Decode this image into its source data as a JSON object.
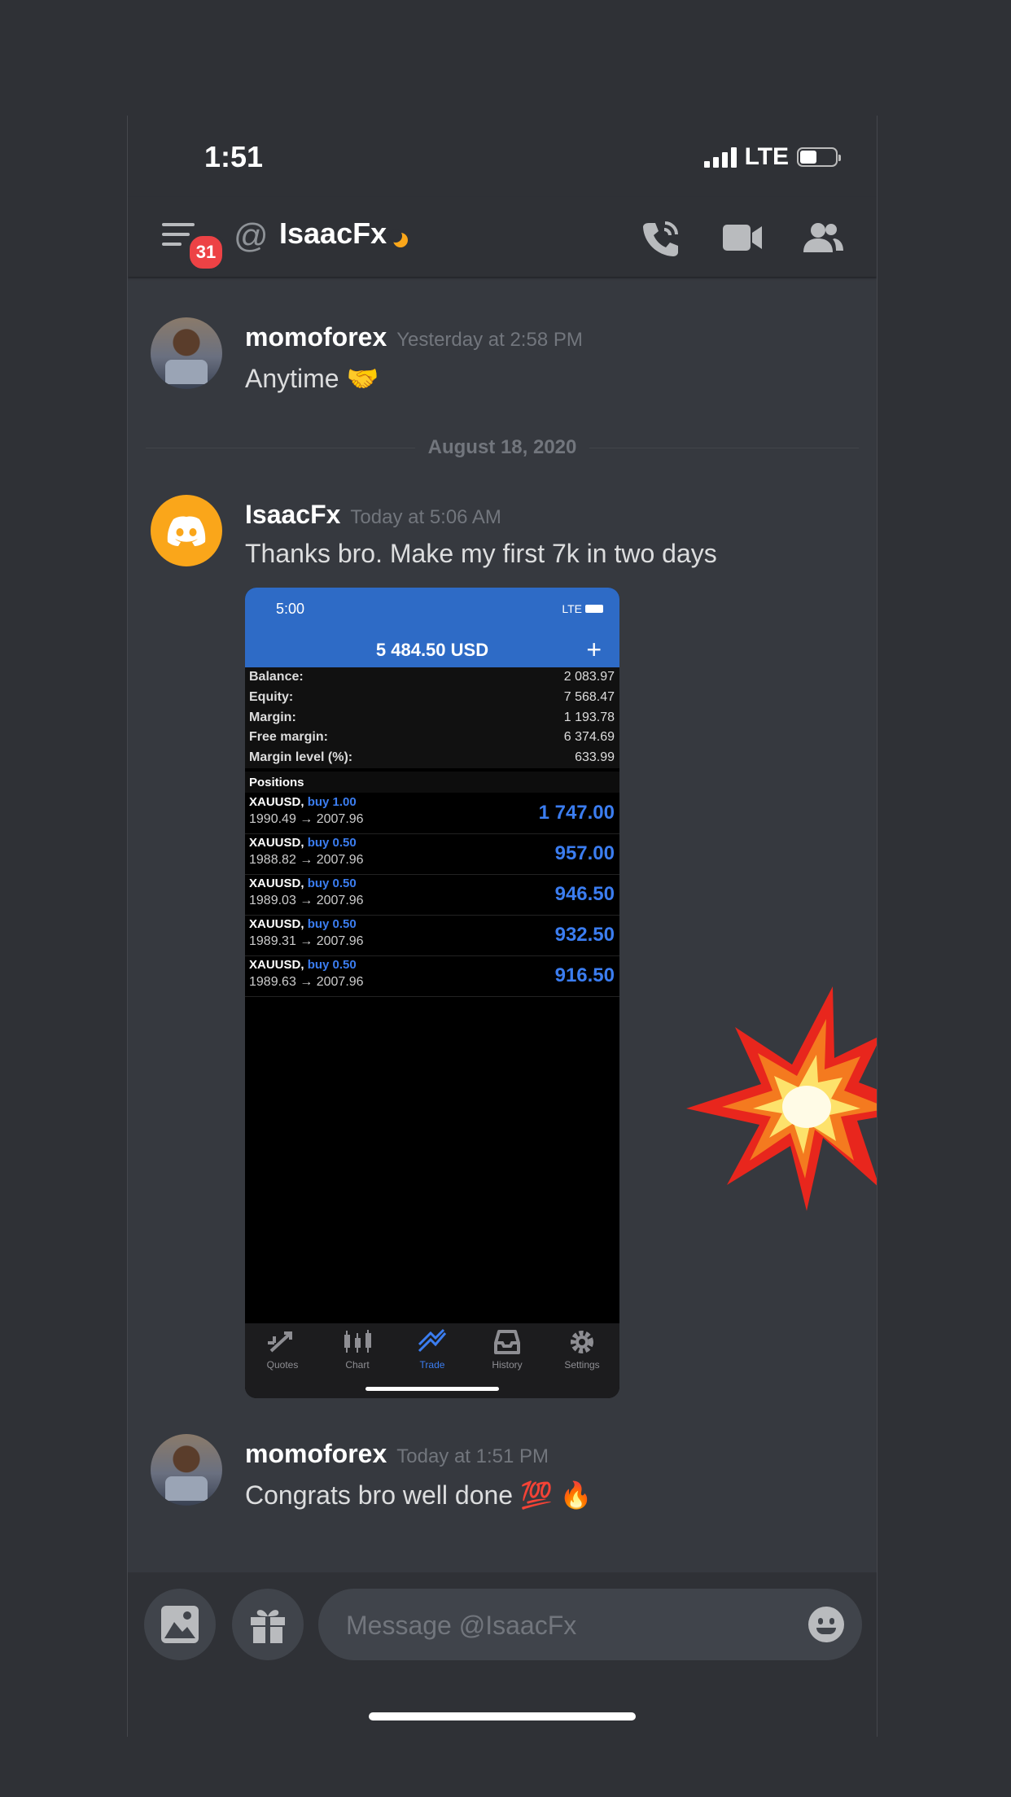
{
  "status_bar": {
    "time": "1:51",
    "network": "LTE"
  },
  "header": {
    "notification_count": "31",
    "at_symbol": "@",
    "channel_name": "IsaacFx",
    "icons": [
      "menu-icon",
      "voice-call-icon",
      "video-call-icon",
      "members-icon"
    ]
  },
  "messages": [
    {
      "author": "momoforex",
      "timestamp": "Yesterday at 2:58 PM",
      "text": "Anytime 🤝"
    },
    {
      "author": "IsaacFx",
      "timestamp": "Today at 5:06 AM",
      "text": "Thanks bro. Make my first 7k in two days"
    },
    {
      "author": "momoforex",
      "timestamp": "Today at 1:51 PM",
      "text": "Congrats bro well done 💯 🔥"
    }
  ],
  "date_divider": "August 18, 2020",
  "attachment": {
    "status_time": "5:00",
    "status_network": "LTE",
    "total": "5 484.50 USD",
    "plus": "+",
    "account": [
      {
        "label": "Balance:",
        "value": "2 083.97"
      },
      {
        "label": "Equity:",
        "value": "7 568.47"
      },
      {
        "label": "Margin:",
        "value": "1 193.78"
      },
      {
        "label": "Free margin:",
        "value": "6 374.69"
      },
      {
        "label": "Margin level (%):",
        "value": "633.99"
      }
    ],
    "positions_label": "Positions",
    "positions": [
      {
        "symbol": "XAUUSD,",
        "side": "buy 1.00",
        "range": "1990.49 → 2007.96",
        "profit": "1 747.00"
      },
      {
        "symbol": "XAUUSD,",
        "side": "buy 0.50",
        "range": "1988.82 → 2007.96",
        "profit": "957.00"
      },
      {
        "symbol": "XAUUSD,",
        "side": "buy 0.50",
        "range": "1989.03 → 2007.96",
        "profit": "946.50"
      },
      {
        "symbol": "XAUUSD,",
        "side": "buy 0.50",
        "range": "1989.31 → 2007.96",
        "profit": "932.50"
      },
      {
        "symbol": "XAUUSD,",
        "side": "buy 0.50",
        "range": "1989.63 → 2007.96",
        "profit": "916.50"
      }
    ],
    "tabs": [
      "Quotes",
      "Chart",
      "Trade",
      "History",
      "Settings"
    ],
    "active_tab": "Trade"
  },
  "composer": {
    "placeholder": "Message @IsaacFx"
  },
  "colors": {
    "background": "#36393f",
    "header": "#2f3136",
    "accent_blue": "#2e6bc6",
    "badge_red": "#ed4245",
    "discord_yellow": "#faa61a"
  }
}
